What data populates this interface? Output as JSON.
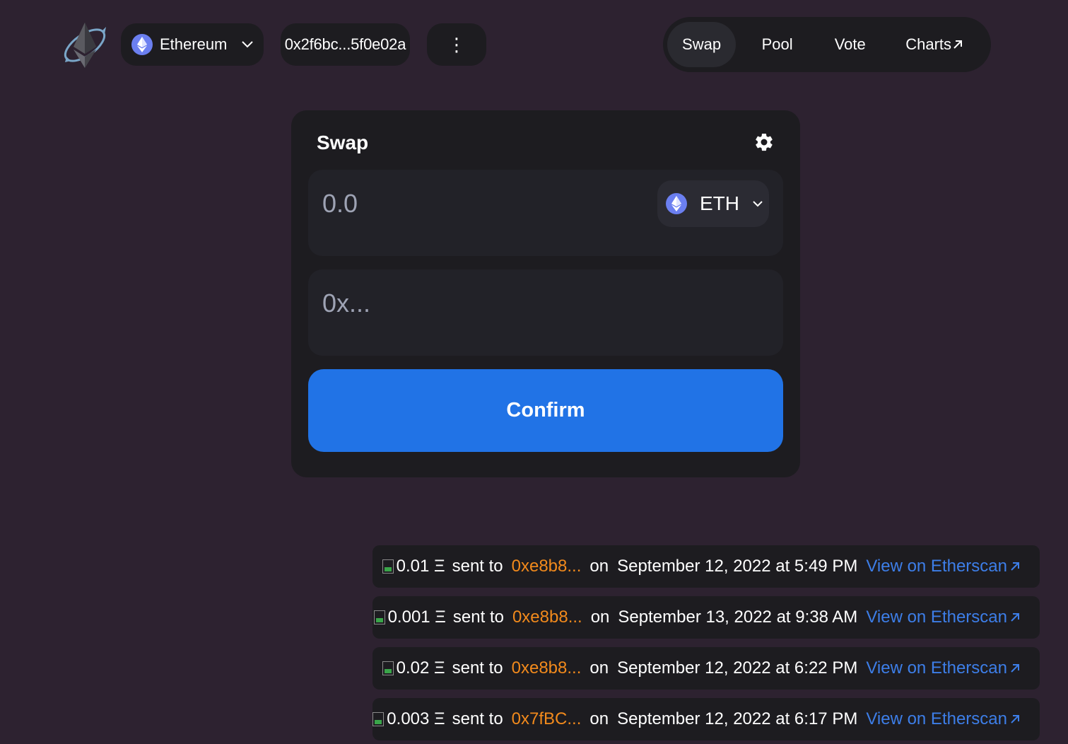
{
  "header": {
    "network": {
      "label": "Ethereum",
      "icon": "ethereum-icon"
    },
    "account": {
      "address": "0x2f6bc...5f0e02a"
    },
    "more": {
      "icon": "vertical-dots-icon",
      "glyph": "⋮"
    },
    "nav": {
      "swap": "Swap",
      "pool": "Pool",
      "vote": "Vote",
      "charts": "Charts",
      "charts_icon": "external-arrow-icon"
    }
  },
  "swap_card": {
    "title": "Swap",
    "settings_icon": "gear-icon",
    "amount": {
      "value": "",
      "placeholder": "0.0"
    },
    "token": {
      "symbol": "ETH",
      "icon": "ethereum-icon"
    },
    "recipient": {
      "value": "",
      "placeholder": "0x..."
    },
    "confirm_label": "Confirm"
  },
  "transactions": [
    {
      "amount": "0.01 Ξ",
      "sent_to_label": "sent to",
      "to": "0xe8b8...",
      "on_label": "on",
      "date": "September 12, 2022 at 5:49 PM",
      "link": "View on Etherscan"
    },
    {
      "amount": "0.001 Ξ",
      "sent_to_label": "sent to",
      "to": "0xe8b8...",
      "on_label": "on",
      "date": "September 13, 2022 at 9:38 AM",
      "link": "View on Etherscan"
    },
    {
      "amount": "0.02 Ξ",
      "sent_to_label": "sent to",
      "to": "0xe8b8...",
      "on_label": "on",
      "date": "September 12, 2022 at 6:22 PM",
      "link": "View on Etherscan"
    },
    {
      "amount": "0.003 Ξ",
      "sent_to_label": "sent to",
      "to": "0x7fBC...",
      "on_label": "on",
      "date": "September 12, 2022 at 6:17 PM",
      "link": "View on Etherscan"
    }
  ],
  "colors": {
    "background": "#2d2230",
    "panel": "#1d1c20",
    "input": "#222228",
    "accent_blue": "#2173e6",
    "address_orange": "#f28a1c",
    "link_blue": "#3d7ee8"
  }
}
